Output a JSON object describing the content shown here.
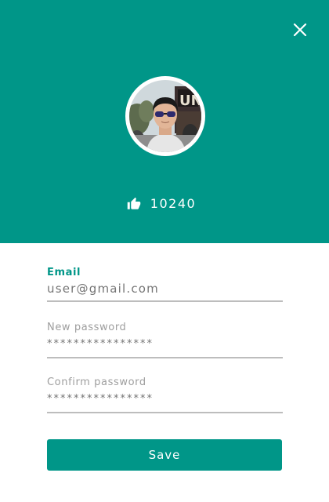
{
  "header": {
    "close_icon": "close-icon",
    "likes_icon": "thumbs-up-icon",
    "likes_count": "10240",
    "color": "#009688"
  },
  "form": {
    "email": {
      "label": "Email",
      "value": "user@gmail.com"
    },
    "new_password": {
      "label": "New password",
      "value": "****************"
    },
    "confirm_password": {
      "label": "Confirm password",
      "value": "****************"
    },
    "save_label": "Save"
  }
}
